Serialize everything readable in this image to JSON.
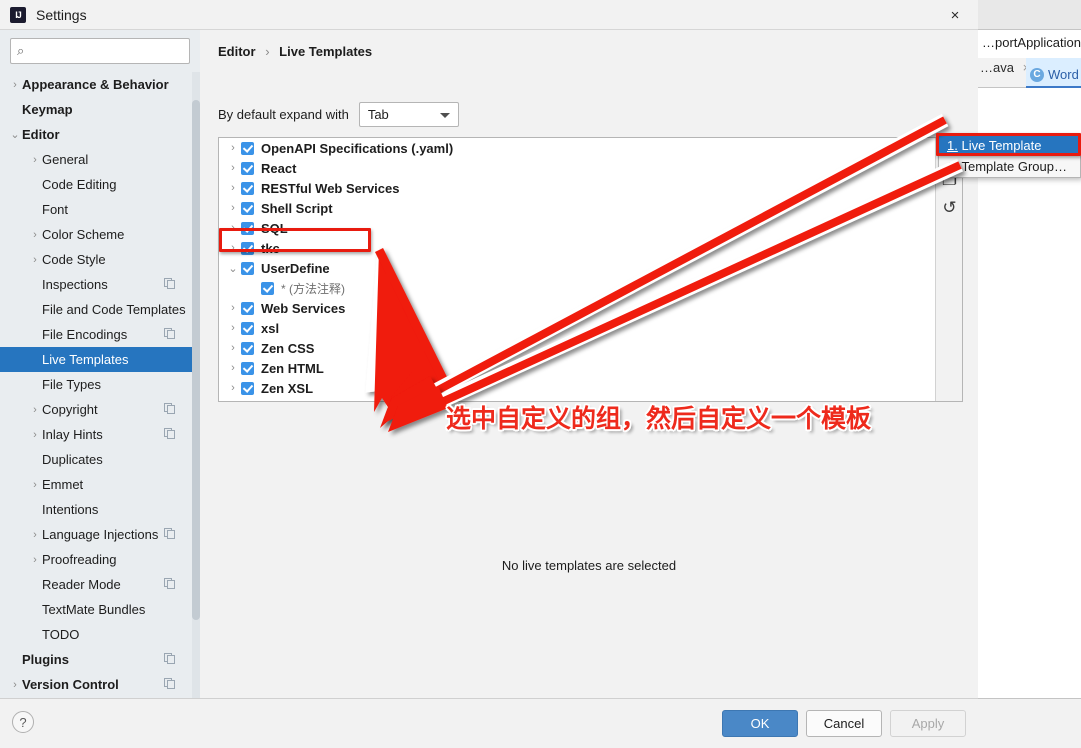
{
  "window": {
    "title": "Settings",
    "logo_text": "IJ",
    "close_icon": "×"
  },
  "search": {
    "placeholder": "",
    "value": "",
    "icon": "⌕"
  },
  "sidebar": {
    "items": [
      {
        "label": "Appearance & Behavior",
        "chevron": "›",
        "bold": true,
        "indent": 0,
        "selected": false,
        "sync": false
      },
      {
        "label": "Keymap",
        "chevron": "",
        "bold": true,
        "indent": 0,
        "selected": false,
        "sync": false
      },
      {
        "label": "Editor",
        "chevron": "⌄",
        "bold": true,
        "indent": 0,
        "selected": false,
        "sync": false
      },
      {
        "label": "General",
        "chevron": "›",
        "bold": false,
        "indent": 1,
        "selected": false,
        "sync": false
      },
      {
        "label": "Code Editing",
        "chevron": "",
        "bold": false,
        "indent": 1,
        "selected": false,
        "sync": false
      },
      {
        "label": "Font",
        "chevron": "",
        "bold": false,
        "indent": 1,
        "selected": false,
        "sync": false
      },
      {
        "label": "Color Scheme",
        "chevron": "›",
        "bold": false,
        "indent": 1,
        "selected": false,
        "sync": false
      },
      {
        "label": "Code Style",
        "chevron": "›",
        "bold": false,
        "indent": 1,
        "selected": false,
        "sync": false
      },
      {
        "label": "Inspections",
        "chevron": "",
        "bold": false,
        "indent": 1,
        "selected": false,
        "sync": true
      },
      {
        "label": "File and Code Templates",
        "chevron": "",
        "bold": false,
        "indent": 1,
        "selected": false,
        "sync": false
      },
      {
        "label": "File Encodings",
        "chevron": "",
        "bold": false,
        "indent": 1,
        "selected": false,
        "sync": true
      },
      {
        "label": "Live Templates",
        "chevron": "",
        "bold": false,
        "indent": 1,
        "selected": true,
        "sync": false
      },
      {
        "label": "File Types",
        "chevron": "",
        "bold": false,
        "indent": 1,
        "selected": false,
        "sync": false
      },
      {
        "label": "Copyright",
        "chevron": "›",
        "bold": false,
        "indent": 1,
        "selected": false,
        "sync": true
      },
      {
        "label": "Inlay Hints",
        "chevron": "›",
        "bold": false,
        "indent": 1,
        "selected": false,
        "sync": true
      },
      {
        "label": "Duplicates",
        "chevron": "",
        "bold": false,
        "indent": 1,
        "selected": false,
        "sync": false
      },
      {
        "label": "Emmet",
        "chevron": "›",
        "bold": false,
        "indent": 1,
        "selected": false,
        "sync": false
      },
      {
        "label": "Intentions",
        "chevron": "",
        "bold": false,
        "indent": 1,
        "selected": false,
        "sync": false
      },
      {
        "label": "Language Injections",
        "chevron": "›",
        "bold": false,
        "indent": 1,
        "selected": false,
        "sync": true
      },
      {
        "label": "Proofreading",
        "chevron": "›",
        "bold": false,
        "indent": 1,
        "selected": false,
        "sync": false
      },
      {
        "label": "Reader Mode",
        "chevron": "",
        "bold": false,
        "indent": 1,
        "selected": false,
        "sync": true
      },
      {
        "label": "TextMate Bundles",
        "chevron": "",
        "bold": false,
        "indent": 1,
        "selected": false,
        "sync": false
      },
      {
        "label": "TODO",
        "chevron": "",
        "bold": false,
        "indent": 1,
        "selected": false,
        "sync": false
      },
      {
        "label": "Plugins",
        "chevron": "",
        "bold": true,
        "indent": 0,
        "selected": false,
        "sync": true
      },
      {
        "label": "Version Control",
        "chevron": "›",
        "bold": true,
        "indent": 0,
        "selected": false,
        "sync": true
      }
    ]
  },
  "content": {
    "breadcrumb": {
      "parent": "Editor",
      "separator": "›",
      "current": "Live Templates"
    },
    "expand": {
      "label": "By default expand with",
      "value": "Tab"
    },
    "empty_message": "No live templates are selected",
    "templates": [
      {
        "label": "OpenAPI Specifications (.yaml)",
        "chevron": "›",
        "checked": true,
        "child": false
      },
      {
        "label": "React",
        "chevron": "›",
        "checked": true,
        "child": false
      },
      {
        "label": "RESTful Web Services",
        "chevron": "›",
        "checked": true,
        "child": false
      },
      {
        "label": "Shell Script",
        "chevron": "›",
        "checked": true,
        "child": false
      },
      {
        "label": "SQL",
        "chevron": "›",
        "checked": true,
        "child": false
      },
      {
        "label": "tkc",
        "chevron": "›",
        "checked": true,
        "child": false
      },
      {
        "label": "UserDefine",
        "chevron": "⌄",
        "checked": true,
        "child": false
      },
      {
        "label": "* (方法注释)",
        "chevron": "",
        "checked": true,
        "child": true
      },
      {
        "label": "Web Services",
        "chevron": "›",
        "checked": true,
        "child": false
      },
      {
        "label": "xsl",
        "chevron": "›",
        "checked": true,
        "child": false
      },
      {
        "label": "Zen CSS",
        "chevron": "›",
        "checked": true,
        "child": false
      },
      {
        "label": "Zen HTML",
        "chevron": "›",
        "checked": true,
        "child": false
      },
      {
        "label": "Zen XSL",
        "chevron": "›",
        "checked": true,
        "child": false
      }
    ],
    "toolbar": [
      {
        "name": "add-button",
        "glyph": "+"
      },
      {
        "name": "copy-button",
        "glyph": "❐"
      },
      {
        "name": "revert-button",
        "glyph": "↺"
      }
    ]
  },
  "popup_menu": {
    "items": [
      {
        "number": "1.",
        "label": "Live Template",
        "highlighted": true
      },
      {
        "number": "2.",
        "label": "Template Group…",
        "highlighted": false
      }
    ]
  },
  "footer": {
    "help": "?",
    "ok": "OK",
    "cancel": "Cancel",
    "apply": "Apply"
  },
  "annotation": {
    "text": "选中自定义的组，然后自定义一个模板",
    "color": "#ee2a1c",
    "highlight_color": "#e81b0f"
  },
  "background_ide": {
    "breadcrumb": "…portApplication",
    "tab_inactive": "…ava",
    "tab_inactive_close": "×",
    "tab_active_badge": "C",
    "tab_active_label": "Word"
  },
  "colors": {
    "accent_blue": "#2675bf",
    "checkbox_blue": "#3a93e8",
    "ok_button": "#4a88c7",
    "annotation_red": "#ee2a1c"
  }
}
